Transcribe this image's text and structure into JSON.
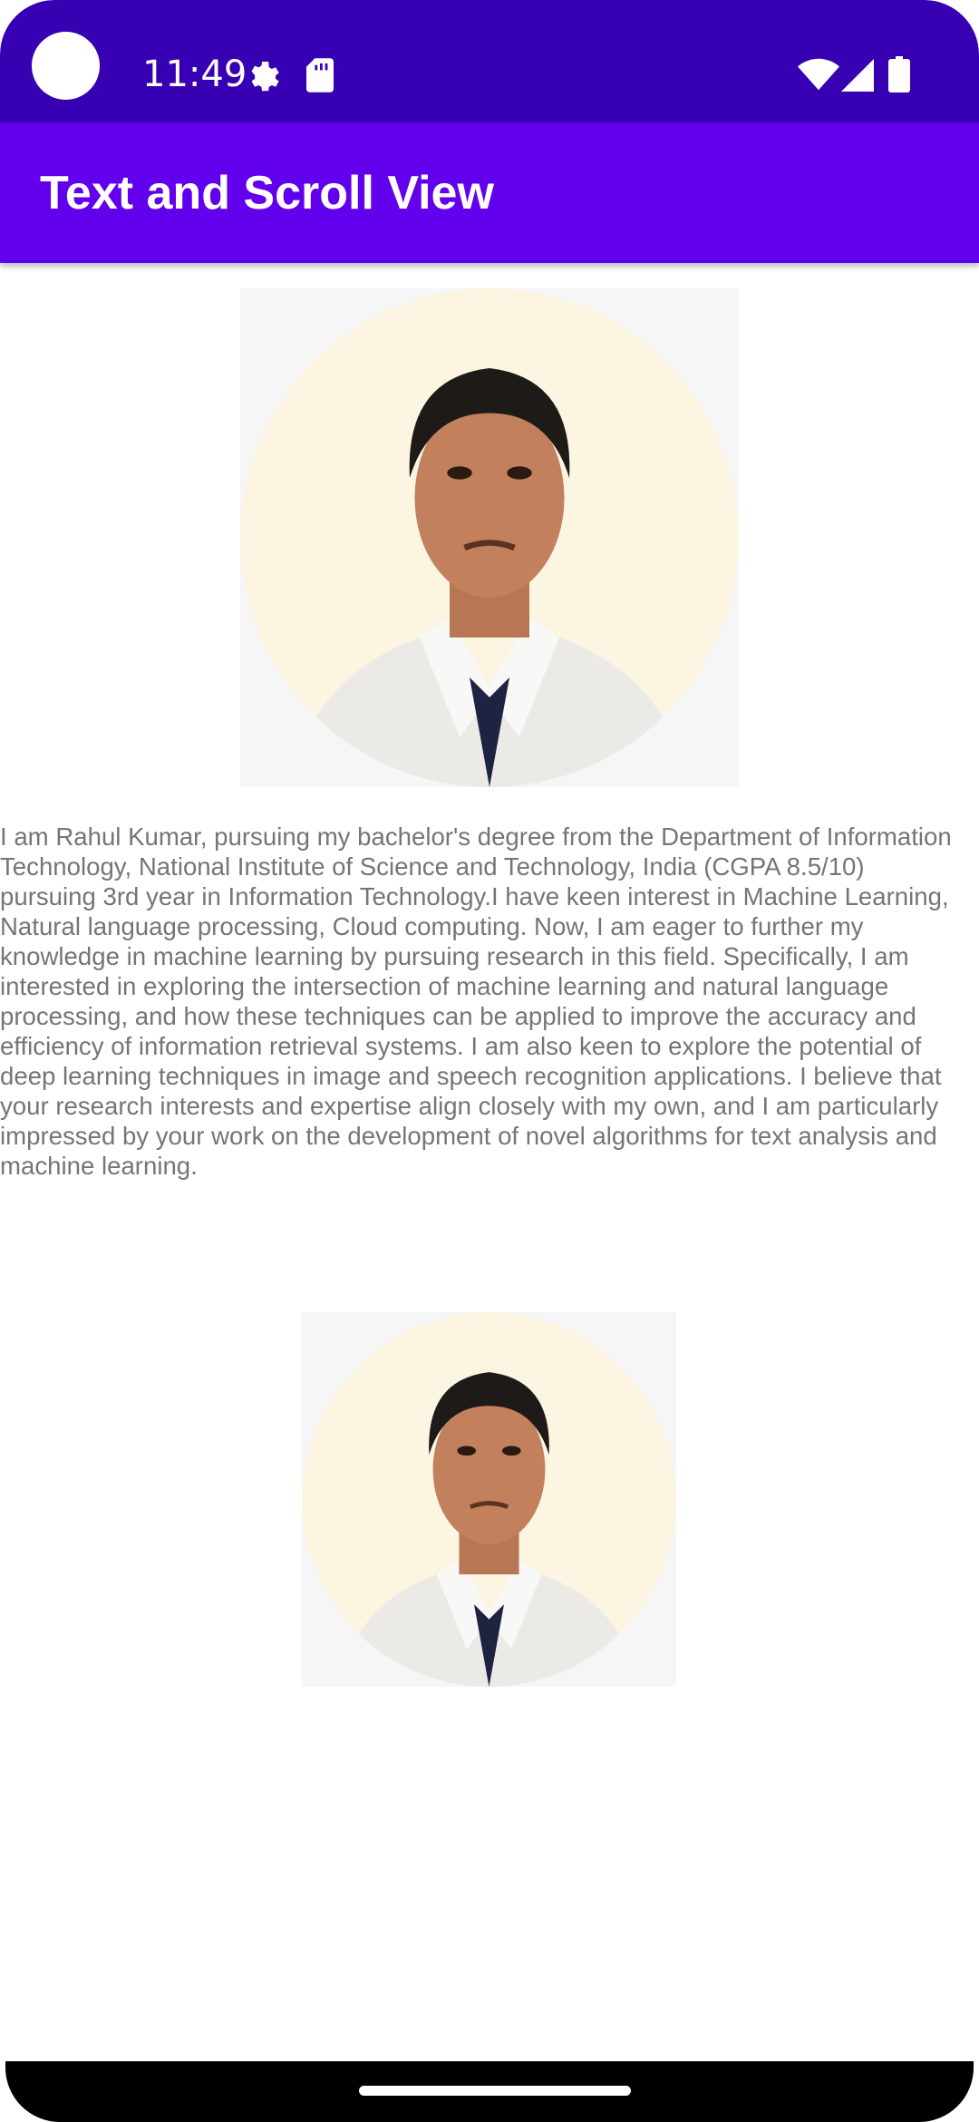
{
  "status_bar": {
    "time": "11:49",
    "icons": [
      "gear-icon",
      "sd-card-icon",
      "wifi-icon",
      "signal-icon",
      "battery-icon"
    ]
  },
  "app_bar": {
    "title": "Text and Scroll View"
  },
  "content": {
    "images": [
      {
        "name": "portrait-photo-large",
        "description": "portrait"
      },
      {
        "name": "portrait-photo-small",
        "description": "portrait"
      }
    ],
    "bio_lines": [
      "I am Rahul Kumar, pursuing my bachelor's degree from the Department of Information",
      "Technology, National Institute of Science and Technology, India (CGPA 8.5/10)",
      "pursuing 3rd year in Information Technology.I have keen interest in Machine Learning,",
      "Natural language processing, Cloud computing. Now, I am eager to further my",
      "knowledge in machine learning by pursuing research in this field. Specifically, I am",
      "interested in exploring the intersection of machine learning and natural language",
      "processing, and how these techniques can be applied to improve the accuracy and",
      "efficiency of information retrieval systems. I am also keen to explore the potential of",
      "deep learning techniques in image and speech recognition applications. I believe that",
      "your research interests and expertise align closely with my own, and I am particularly",
      "impressed by your work on the development of novel algorithms for text analysis and",
      "machine learning."
    ]
  },
  "colors": {
    "status_bar": "#3700b3",
    "app_bar": "#6200ee",
    "body_text": "#757575"
  }
}
